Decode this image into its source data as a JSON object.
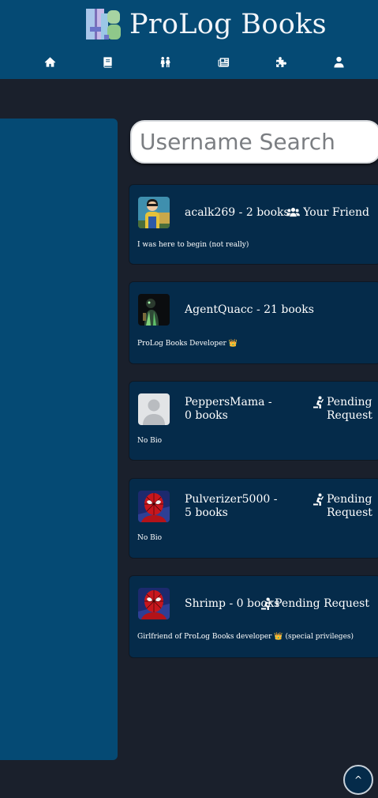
{
  "header": {
    "brand": "ProLog Books",
    "nav": [
      "home-icon",
      "book-icon",
      "people-icon",
      "newspaper-icon",
      "puzzle-icon",
      "user-icon"
    ]
  },
  "search": {
    "placeholder": "Username Search",
    "value": ""
  },
  "users": [
    {
      "name": "acalk269 - 2 books",
      "status": "Your Friend",
      "status_icon": "users-icon",
      "bio": "I was here to begin (not really)",
      "avatar": "invincible-avatar"
    },
    {
      "name": "AgentQuacc - 21 books",
      "status": "",
      "bio": "ProLog Books Developer",
      "bio_suffix": "👑",
      "avatar": "dark-figure-avatar"
    },
    {
      "name": "PeppersMama - 0 books",
      "status": "Pending Request",
      "status_icon": "praying-icon",
      "bio": "No Bio",
      "avatar": "default-avatar"
    },
    {
      "name": "Pulverizer5000 - 5 books",
      "status": "Pending Request",
      "status_icon": "praying-icon",
      "bio": "No Bio",
      "avatar": "spiderman-avatar"
    },
    {
      "name": "Shrimp - 0 books",
      "status": "Pending Request",
      "status_icon": "praying-icon",
      "bio": "Girlfriend of ProLog Books developer",
      "bio_crown": "👑",
      "bio_suffix": "(special privileges)",
      "avatar": "spiderman-avatar"
    }
  ],
  "scroll_top": {
    "label": "^"
  },
  "colors": {
    "header": "#054a74",
    "background": "#1a202c",
    "card": "#052b4a",
    "crown": "#f2b53c"
  }
}
